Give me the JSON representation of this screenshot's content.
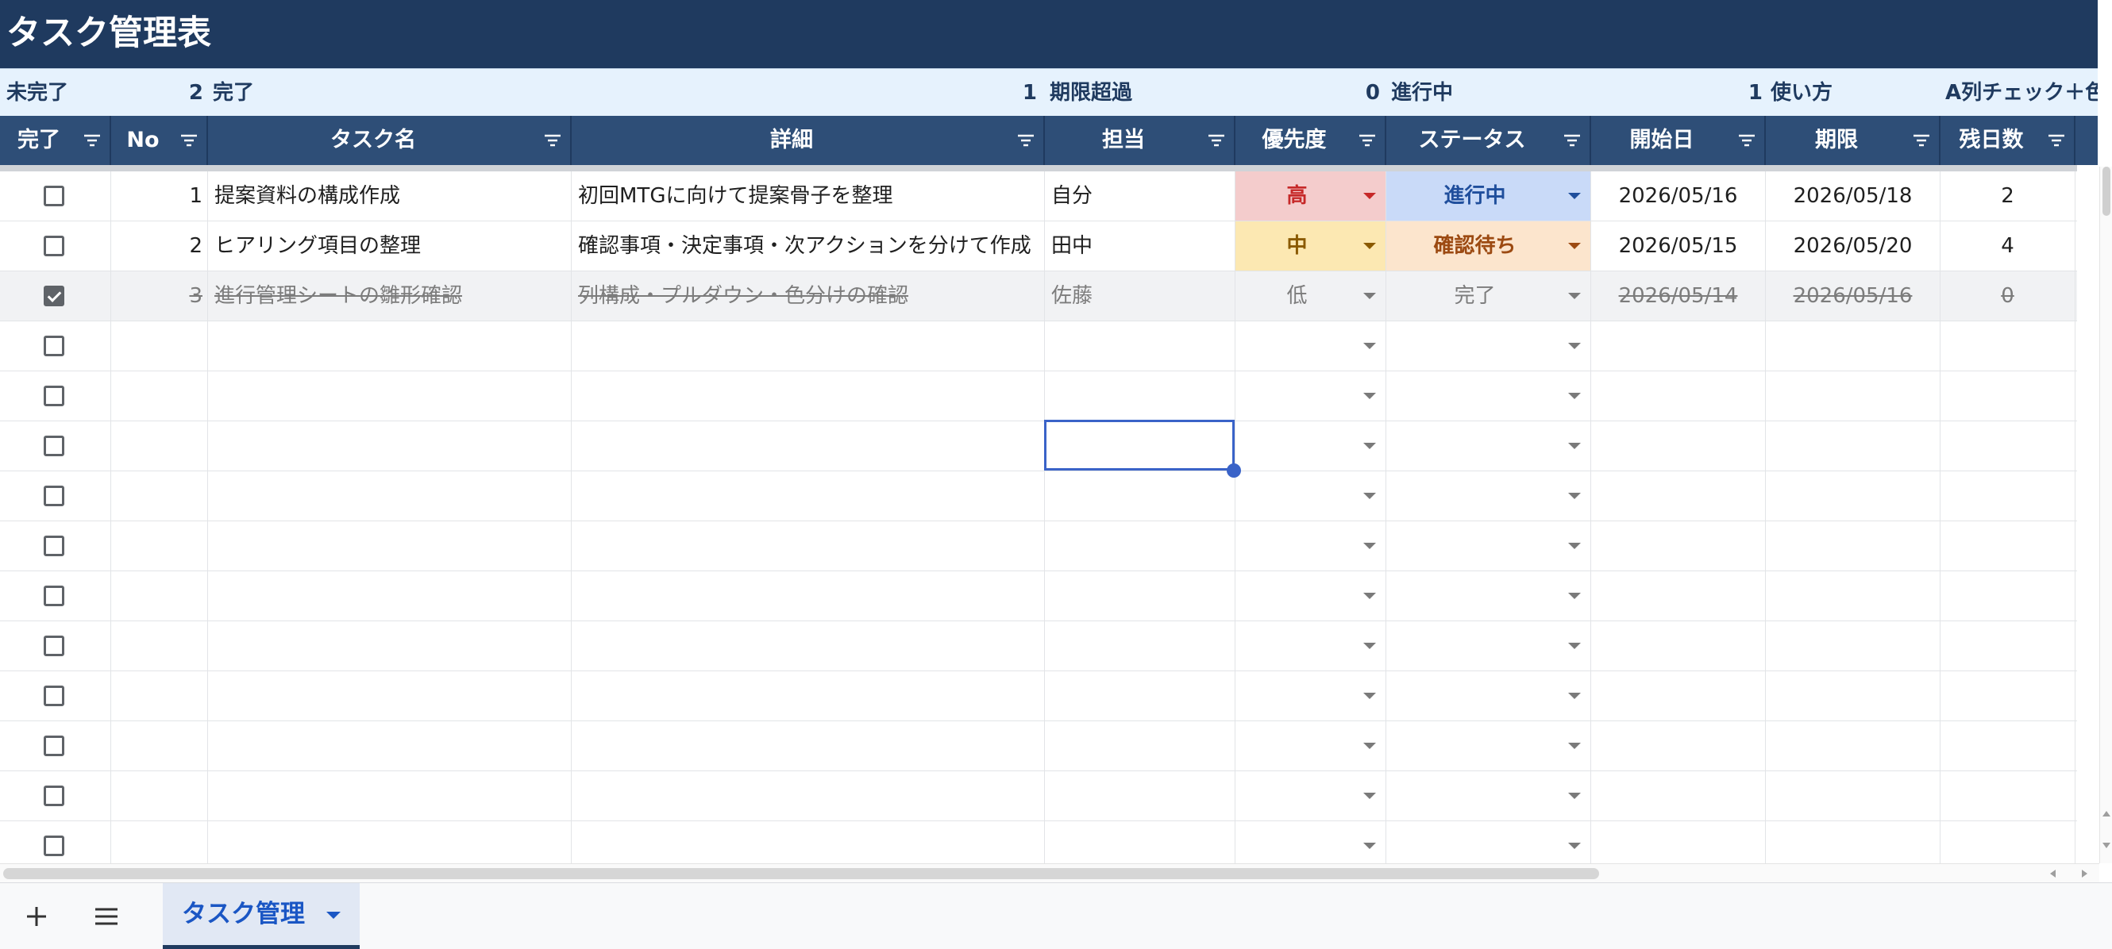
{
  "title": "タスク管理表",
  "summary": [
    {
      "label": "未完了",
      "value": "2"
    },
    {
      "label": "完了",
      "value": "1"
    },
    {
      "label": "期限超過",
      "value": "0"
    },
    {
      "label": "進行中",
      "value": "1"
    },
    {
      "label": "使い方",
      "value": ""
    },
    {
      "label": "A列チェック＋色",
      "value": ""
    }
  ],
  "columns": [
    "完了",
    "No",
    "タスク名",
    "詳細",
    "担当",
    "優先度",
    "ステータス",
    "開始日",
    "期限",
    "残日数"
  ],
  "rows": [
    {
      "checked": false,
      "no": "1",
      "name": "提案資料の構成作成",
      "detail": "初回MTGに向けて提案骨子を整理",
      "owner": "自分",
      "priority": "高",
      "status": "進行中",
      "start": "2026/05/16",
      "due": "2026/05/18",
      "remaining": "2"
    },
    {
      "checked": false,
      "no": "2",
      "name": "ヒアリング項目の整理",
      "detail": "確認事項・決定事項・次アクションを分けて作成",
      "owner": "田中",
      "priority": "中",
      "status": "確認待ち",
      "start": "2026/05/15",
      "due": "2026/05/20",
      "remaining": "4"
    },
    {
      "checked": true,
      "no": "3",
      "name": "進行管理シートの雛形確認",
      "detail": "列構成・プルダウン・色分けの確認",
      "owner": "佐藤",
      "priority": "低",
      "status": "完了",
      "start": "2026/05/14",
      "due": "2026/05/16",
      "remaining": "0"
    }
  ],
  "empty_rows": 11,
  "colors": {
    "title_bg": "#1f3a5f",
    "header_bg": "#2e4e77",
    "summary_bg": "#e6f2fd",
    "priority_high_bg": "#f4cccc",
    "priority_high_text": "#c62828",
    "priority_mid_bg": "#fce8b2",
    "priority_mid_text": "#8a5a00",
    "status_progress_bg": "#c9daf8",
    "status_progress_text": "#1f4e9c",
    "status_waiting_bg": "#fce5cd",
    "status_waiting_text": "#9c4a12",
    "selection": "#3a63c8"
  },
  "icons": {
    "header_filter": "filter-icon",
    "dropdown": "dropdown-arrow-icon",
    "add_sheet": "plus-icon",
    "all_sheets": "menu-icon"
  },
  "sheet_tab": {
    "label": "タスク管理"
  }
}
